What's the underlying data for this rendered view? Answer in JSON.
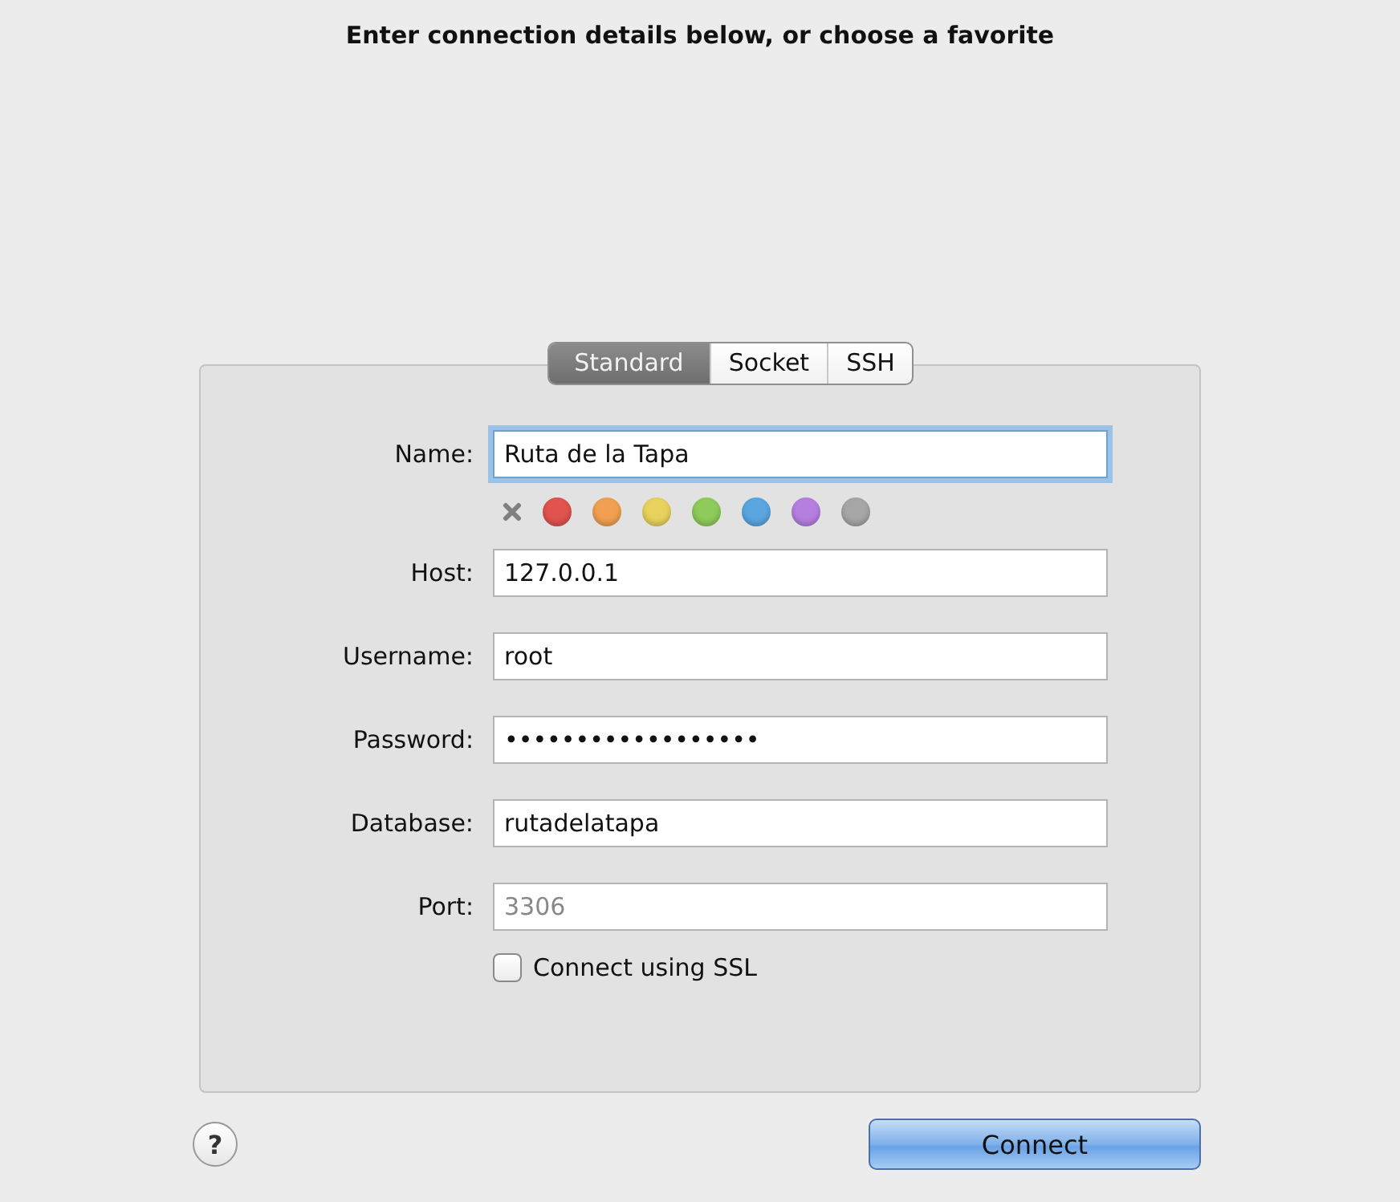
{
  "heading": "Enter connection details below, or choose a favorite",
  "tabs": [
    {
      "label": "Standard",
      "selected": true
    },
    {
      "label": "Socket",
      "selected": false
    },
    {
      "label": "SSH",
      "selected": false
    }
  ],
  "name_field": {
    "label": "Name:",
    "value": "Ruta de la Tapa",
    "focused": true
  },
  "colors": [
    {
      "kind": "none"
    },
    {
      "kind": "swatch",
      "color": "#e0534e"
    },
    {
      "kind": "swatch",
      "color": "#f0a050"
    },
    {
      "kind": "swatch",
      "color": "#e8d15c"
    },
    {
      "kind": "swatch",
      "color": "#8ecb5a"
    },
    {
      "kind": "swatch",
      "color": "#5aa6e0"
    },
    {
      "kind": "swatch",
      "color": "#b57fe0"
    },
    {
      "kind": "swatch",
      "color": "#a6a6a6"
    }
  ],
  "fields": [
    {
      "label": "Host:",
      "value": "127.0.0.1"
    },
    {
      "label": "Username:",
      "value": "root"
    },
    {
      "label": "Password:",
      "value": "••••••••••••••••••"
    },
    {
      "label": "Database:",
      "value": "rutadelatapa"
    },
    {
      "label": "Port:",
      "placeholder": "3306"
    }
  ],
  "ssl_checkbox": {
    "label": "Connect using SSL",
    "checked": false
  },
  "help_button": {
    "label": "?"
  },
  "connect_button": {
    "label": "Connect"
  }
}
